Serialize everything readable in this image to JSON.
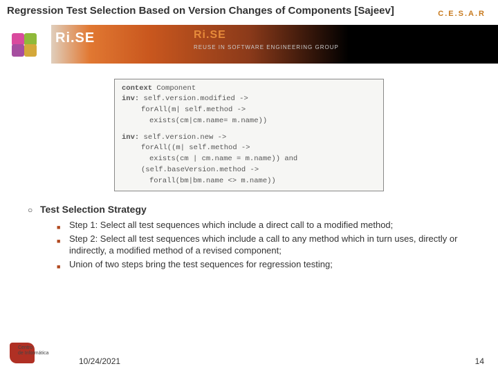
{
  "title": "Regression Test Selection Based on Version Changes of Components [Sajeev]",
  "logo_text": "C.E.S.A.R",
  "banner": {
    "rise": "Ri.SE",
    "rise2": "Ri.SE",
    "subtitle": "REUSE IN SOFTWARE ENGINEERING GROUP"
  },
  "code": {
    "l1a": "context",
    "l1b": " Component",
    "l2a": "inv:",
    "l2b": " self.version.modified ->",
    "l3": "forAll(m| self.method ->",
    "l4": "exists(cm|cm.name= m.name))",
    "l5a": "inv:",
    "l5b": " self.version.new ->",
    "l6": "forAll((m| self.method ->",
    "l7": "exists(cm | cm.name = m.name)) and",
    "l8": "(self.baseVersion.method ->",
    "l9": "forall(bm|bm.name <> m.name))"
  },
  "section_heading": "Test Selection Strategy",
  "steps": [
    "Step 1: Select all test sequences which include a direct call to a modified method;",
    "Step 2: Select all test sequences which include a call to any method which in turn uses, directly or indirectly, a modified method of a revised component;",
    "Union of two steps bring the test sequences for regression testing;"
  ],
  "footer": {
    "logo_line1": "Centro",
    "logo_line2": "de Informática",
    "date": "10/24/2021",
    "page": "14"
  }
}
